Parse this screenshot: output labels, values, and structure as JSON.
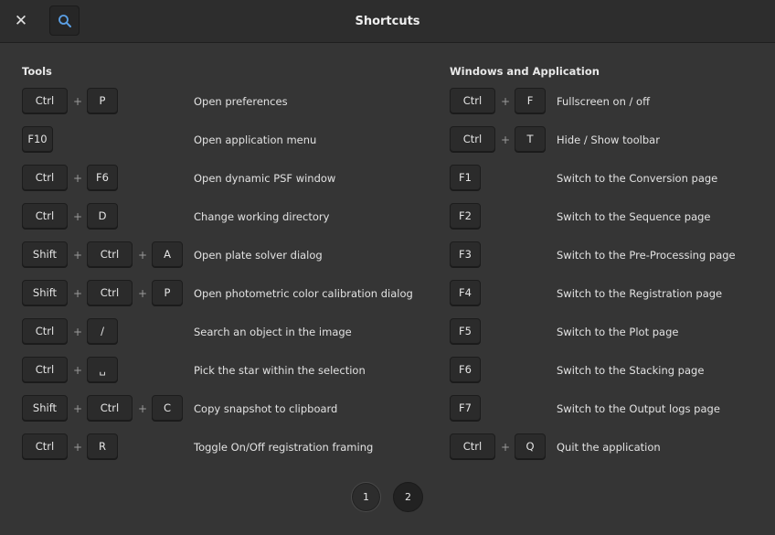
{
  "window": {
    "title": "Shortcuts",
    "close_icon": "close-icon",
    "search_icon": "search-icon"
  },
  "sections": [
    {
      "title": "Tools",
      "items": [
        {
          "keys": [
            "Ctrl",
            "P"
          ],
          "desc": "Open preferences"
        },
        {
          "keys": [
            "F10"
          ],
          "desc": "Open application menu"
        },
        {
          "keys": [
            "Ctrl",
            "F6"
          ],
          "desc": "Open dynamic PSF window"
        },
        {
          "keys": [
            "Ctrl",
            "D"
          ],
          "desc": "Change working directory"
        },
        {
          "keys": [
            "Shift",
            "Ctrl",
            "A"
          ],
          "desc": "Open plate solver dialog"
        },
        {
          "keys": [
            "Shift",
            "Ctrl",
            "P"
          ],
          "desc": "Open photometric color calibration dialog"
        },
        {
          "keys": [
            "Ctrl",
            "/"
          ],
          "desc": "Search an object in the image"
        },
        {
          "keys": [
            "Ctrl",
            "␣"
          ],
          "desc": "Pick the star within the selection"
        },
        {
          "keys": [
            "Shift",
            "Ctrl",
            "C"
          ],
          "desc": "Copy snapshot to clipboard"
        },
        {
          "keys": [
            "Ctrl",
            "R"
          ],
          "desc": "Toggle On/Off registration framing"
        }
      ]
    },
    {
      "title": "Windows and Application",
      "items": [
        {
          "keys": [
            "Ctrl",
            "F"
          ],
          "desc": "Fullscreen on / off"
        },
        {
          "keys": [
            "Ctrl",
            "T"
          ],
          "desc": "Hide / Show toolbar"
        },
        {
          "keys": [
            "F1"
          ],
          "desc": "Switch to the Conversion page"
        },
        {
          "keys": [
            "F2"
          ],
          "desc": "Switch to the Sequence page"
        },
        {
          "keys": [
            "F3"
          ],
          "desc": "Switch to the Pre-Processing page"
        },
        {
          "keys": [
            "F4"
          ],
          "desc": "Switch to the Registration page"
        },
        {
          "keys": [
            "F5"
          ],
          "desc": "Switch to the Plot page"
        },
        {
          "keys": [
            "F6"
          ],
          "desc": "Switch to the Stacking page"
        },
        {
          "keys": [
            "F7"
          ],
          "desc": "Switch to the Output logs page"
        },
        {
          "keys": [
            "Ctrl",
            "Q"
          ],
          "desc": "Quit the application"
        }
      ]
    }
  ],
  "plus_sign": "+",
  "pagination": {
    "pages": [
      "1",
      "2"
    ],
    "current": "1"
  }
}
